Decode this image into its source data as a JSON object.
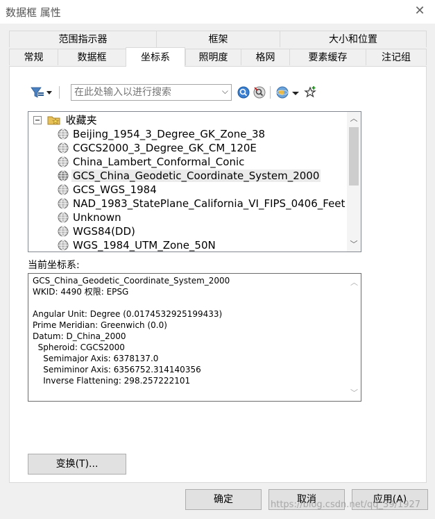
{
  "window": {
    "title": "数据框 属性",
    "close_icon": "close-icon"
  },
  "tabs_row1": [
    "范围指示器",
    "框架",
    "大小和位置"
  ],
  "tabs_row2": [
    "常规",
    "数据框",
    "坐标系",
    "照明度",
    "格网",
    "要素缓存",
    "注记组"
  ],
  "active_tab": "坐标系",
  "toolbar": {
    "search_placeholder": "在此处输入以进行搜索",
    "icons": [
      "filter-icon",
      "dropdown-arrow-icon",
      "search-icon",
      "clear-search-icon",
      "globe-icon",
      "dropdown-arrow-icon",
      "add-favorite-icon"
    ]
  },
  "tree": {
    "root_label": "收藏夹",
    "items": [
      "Beijing_1954_3_Degree_GK_Zone_38",
      "CGCS2000_3_Degree_GK_CM_120E",
      "China_Lambert_Conformal_Conic",
      "GCS_China_Geodetic_Coordinate_System_2000",
      "GCS_WGS_1984",
      "NAD_1983_StatePlane_California_VI_FIPS_0406_Feet",
      "Unknown",
      "WGS84(DD)",
      "WGS_1984_UTM_Zone_50N"
    ],
    "selected_index": 3
  },
  "current_cs": {
    "label": "当前坐标系:",
    "lines": [
      "GCS_China_Geodetic_Coordinate_System_2000",
      "WKID: 4490 权限: EPSG",
      "",
      "Angular Unit: Degree (0.0174532925199433)",
      "Prime Meridian: Greenwich (0.0)",
      "Datum: D_China_2000",
      "  Spheroid: CGCS2000",
      "    Semimajor Axis: 6378137.0",
      "    Semiminor Axis: 6356752.314140356",
      "    Inverse Flattening: 298.257222101"
    ]
  },
  "buttons": {
    "transform": "变换(T)...",
    "ok": "确定",
    "cancel": "取消",
    "apply": "应用(A)"
  },
  "watermark": "https://blog.csdn.net/qq_39/1927"
}
